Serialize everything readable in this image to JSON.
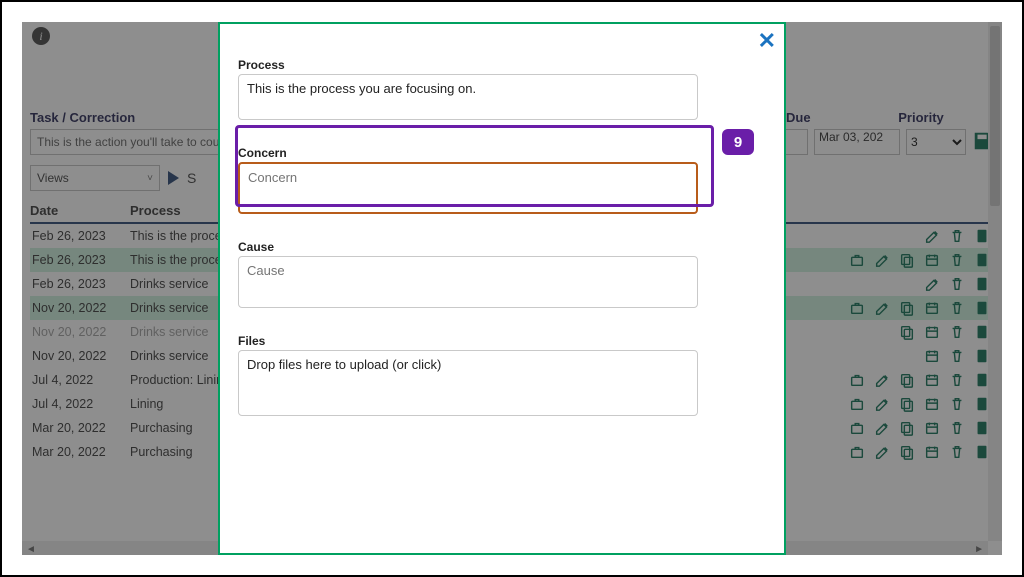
{
  "callout_number": "9",
  "header": {
    "task_label": "Task / Correction",
    "due_label": "Due",
    "priority_label": "Priority",
    "task_hint": "This is the action you'll take to counter",
    "due_value": "Mar 03, 202",
    "priority_value": "3",
    "views_label": "Views",
    "search_stub": "S"
  },
  "columns": {
    "date": "Date",
    "process": "Process"
  },
  "rows": [
    {
      "date": "Feb 26, 2023",
      "process": "This is the process",
      "hl": false,
      "faded": false,
      "icons": [
        "edit",
        "trash",
        "doc"
      ]
    },
    {
      "date": "Feb 26, 2023",
      "process": "This is the process",
      "hl": true,
      "faded": false,
      "icons": [
        "brief",
        "edit",
        "copy",
        "cal",
        "trash",
        "doc"
      ]
    },
    {
      "date": "Feb 26, 2023",
      "process": "Drinks service",
      "hl": false,
      "faded": false,
      "icons": [
        "edit",
        "trash",
        "doc"
      ]
    },
    {
      "date": "Nov 20, 2022",
      "process": "Drinks service",
      "hl": true,
      "faded": false,
      "icons": [
        "brief",
        "edit",
        "copy",
        "cal",
        "trash",
        "doc"
      ]
    },
    {
      "date": "Nov 20, 2022",
      "process": "Drinks service",
      "hl": false,
      "faded": true,
      "icons": [
        "copy",
        "cal",
        "trash",
        "doc"
      ]
    },
    {
      "date": "Nov 20, 2022",
      "process": "Drinks service",
      "hl": false,
      "faded": false,
      "icons": [
        "cal",
        "trash",
        "doc"
      ]
    },
    {
      "date": "Jul 4, 2022",
      "process": "Production: Lining",
      "hl": false,
      "faded": false,
      "icons": [
        "brief",
        "edit",
        "copy",
        "cal",
        "trash",
        "doc"
      ]
    },
    {
      "date": "Jul 4, 2022",
      "process": "Lining",
      "hl": false,
      "faded": false,
      "icons": [
        "brief",
        "edit",
        "copy",
        "cal",
        "trash",
        "doc"
      ]
    },
    {
      "date": "Mar 20, 2022",
      "process": "Purchasing",
      "hl": false,
      "faded": false,
      "icons": [
        "brief",
        "edit",
        "copy",
        "cal",
        "trash",
        "doc"
      ]
    },
    {
      "date": "Mar 20, 2022",
      "process": "Purchasing",
      "hl": false,
      "faded": false,
      "icons": [
        "brief",
        "edit",
        "copy",
        "cal",
        "trash",
        "doc"
      ]
    }
  ],
  "modal": {
    "process_label": "Process",
    "process_value": "This is the process you are focusing on.",
    "concern_label": "Concern",
    "concern_placeholder": "Concern",
    "cause_label": "Cause",
    "cause_placeholder": "Cause",
    "files_label": "Files",
    "files_hint": "Drop files here to upload (or click)"
  }
}
